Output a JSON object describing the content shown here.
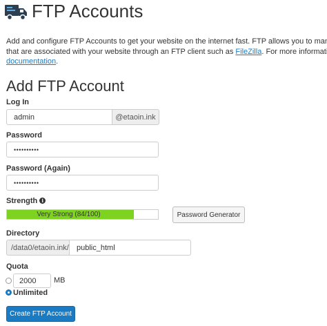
{
  "header": {
    "title": "FTP Accounts",
    "icon": "truck-icon"
  },
  "description": {
    "line1": "Add and configure FTP Accounts to get your website on the internet fast. FTP allows you to manage the files",
    "line2_prefix": "that are associated with your website through an FTP client such as ",
    "filezilla_link": "FileZilla",
    "line2_suffix": ". For more information, read the",
    "documentation_link": "documentation",
    "line3_suffix": "."
  },
  "form": {
    "section_title": "Add FTP Account",
    "login": {
      "label": "Log In",
      "value": "admin",
      "domain_addon": "@etaoin.ink"
    },
    "password": {
      "label": "Password",
      "value": "••••••••••"
    },
    "password_again": {
      "label": "Password (Again)",
      "value": "••••••••••"
    },
    "strength": {
      "label": "Strength",
      "text": "Very Strong (84/100)",
      "percent": 84,
      "color": "#7ed321"
    },
    "password_generator_label": "Password Generator",
    "directory": {
      "label": "Directory",
      "prefix": "/data0/etaoin.ink/",
      "value": "public_html"
    },
    "quota": {
      "label": "Quota",
      "value": "2000",
      "unit": "MB",
      "unlimited_label": "Unlimited",
      "selected": "unlimited"
    },
    "submit_label": "Create FTP Account"
  },
  "colors": {
    "accent": "#1a7bc2",
    "strength": "#7ed321"
  }
}
